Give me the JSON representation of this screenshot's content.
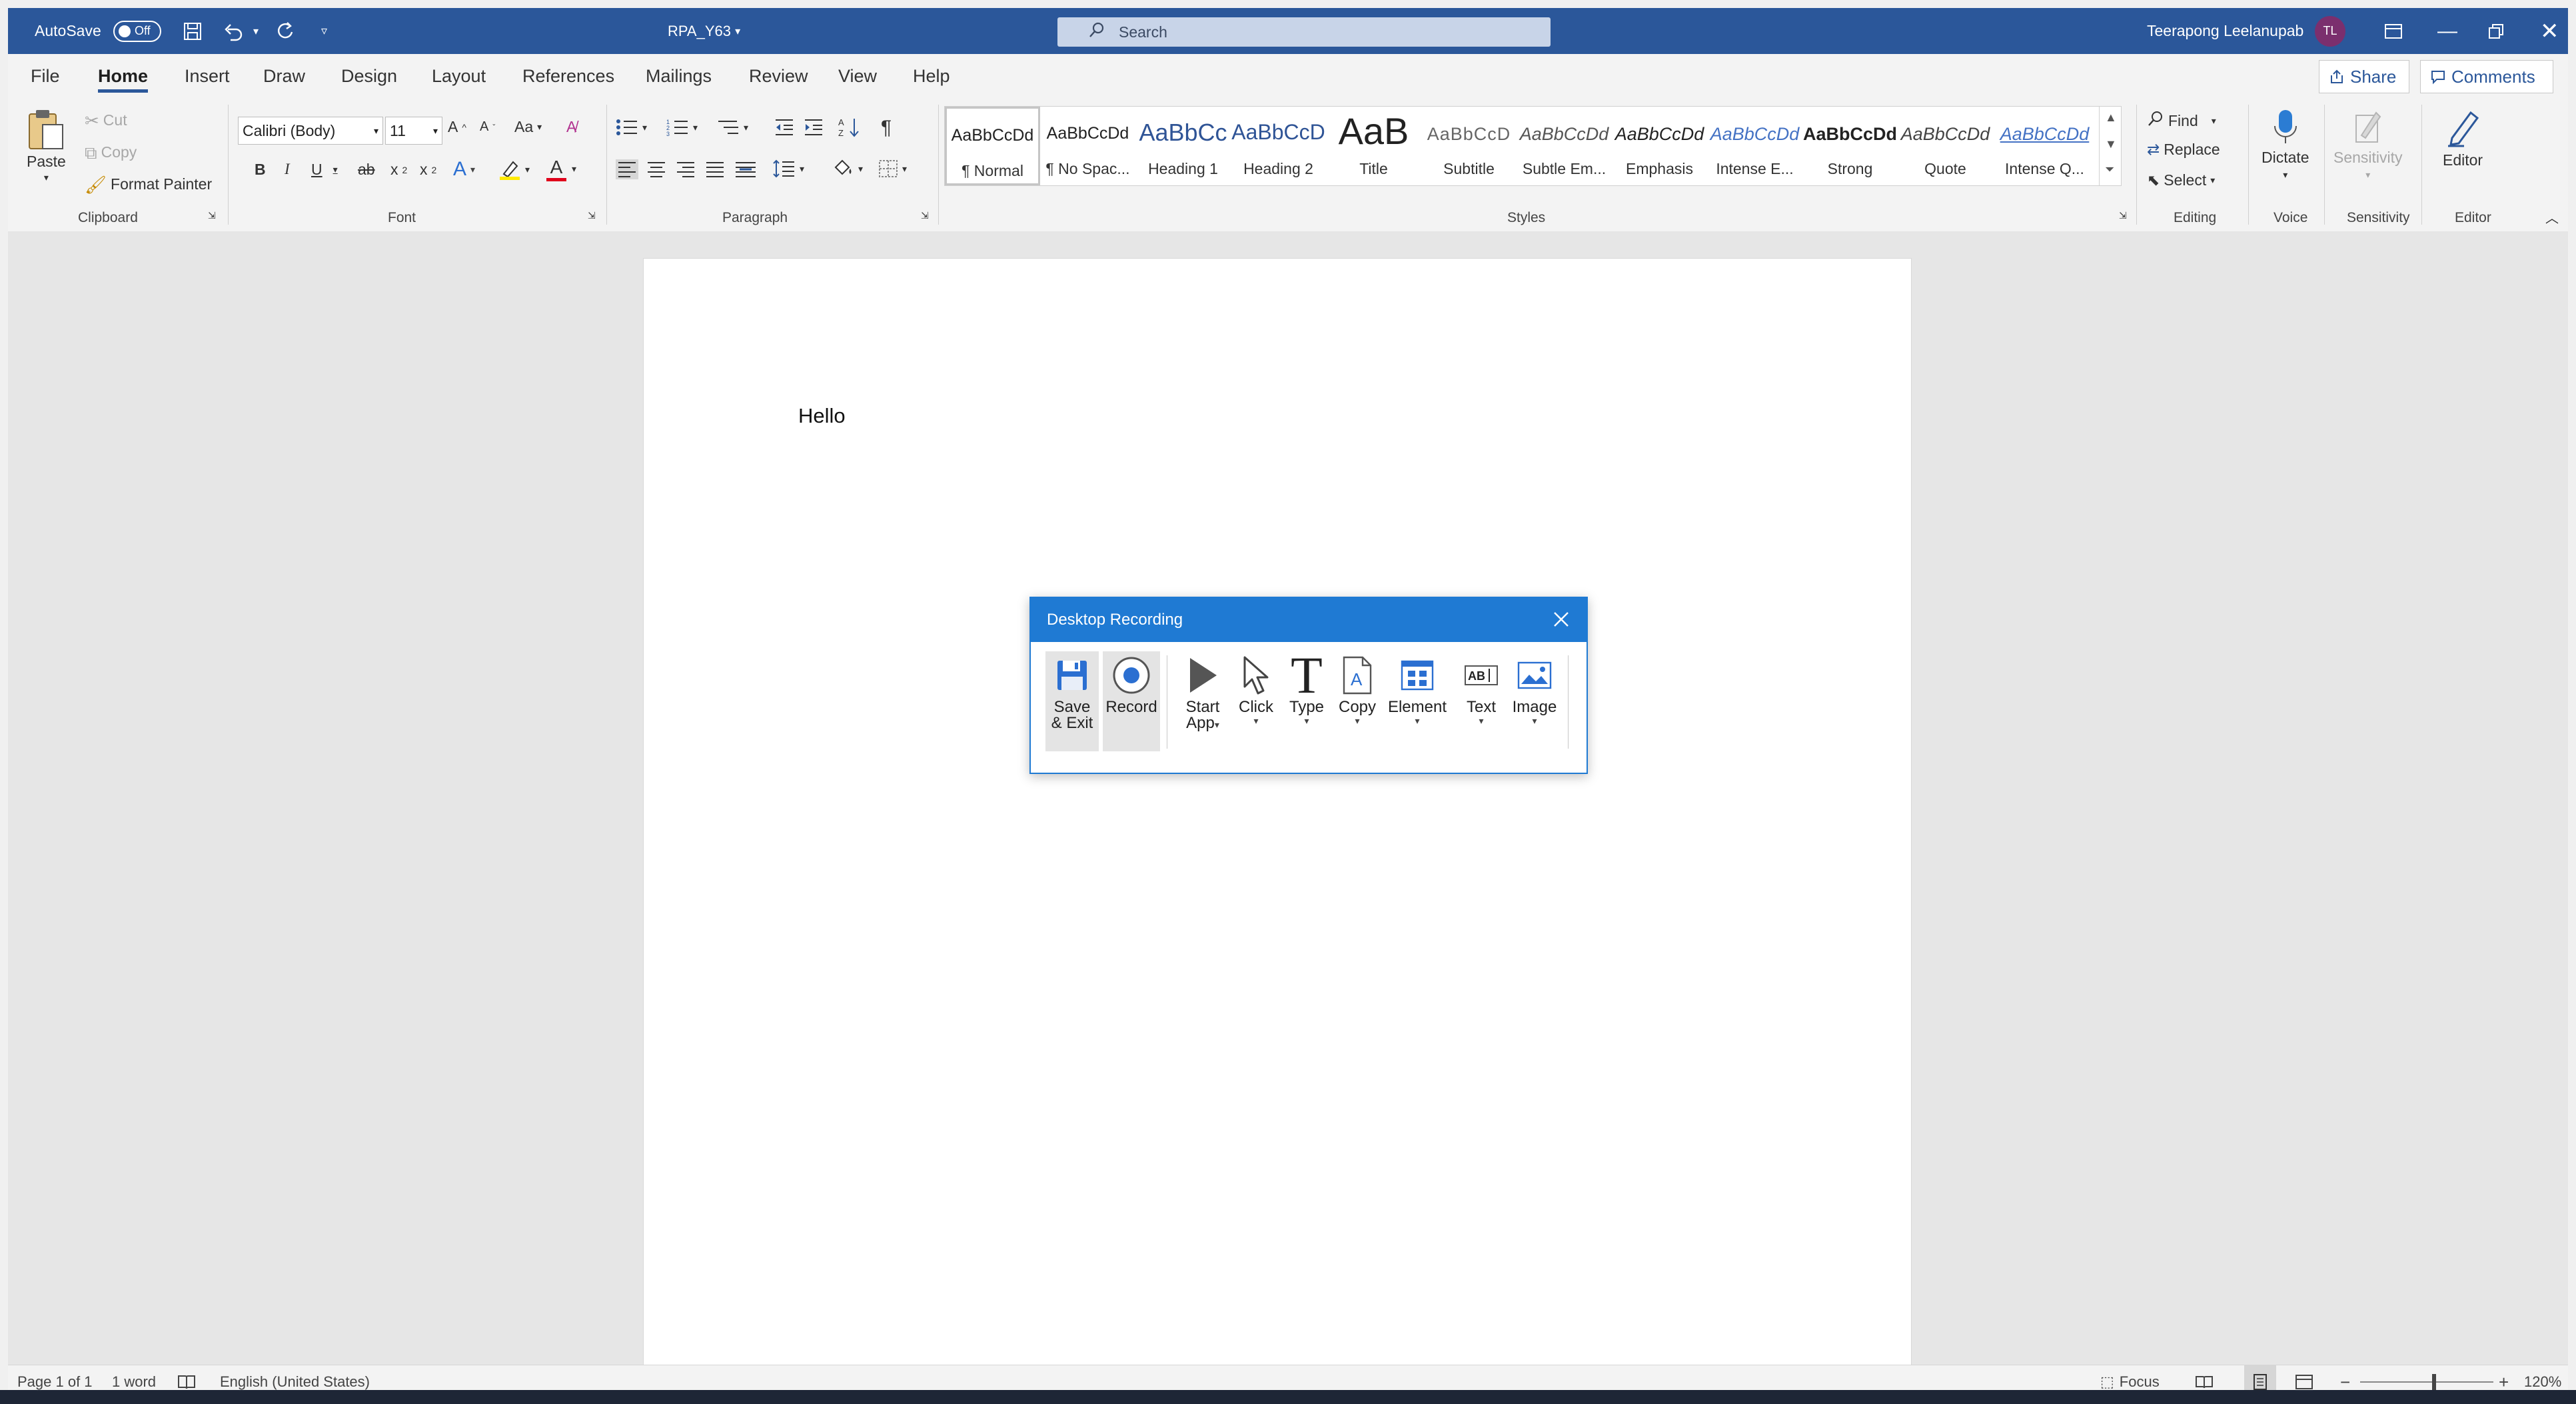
{
  "titlebar": {
    "autosave_label": "AutoSave",
    "autosave_state": "Off",
    "document_title": "RPA_Y63",
    "search_placeholder": "Search",
    "user_name": "Teerapong Leelanupab",
    "user_initials": "TL",
    "bg_color": "#2b579a"
  },
  "tabs": [
    {
      "label": "File"
    },
    {
      "label": "Home",
      "active": true
    },
    {
      "label": "Insert"
    },
    {
      "label": "Draw"
    },
    {
      "label": "Design"
    },
    {
      "label": "Layout"
    },
    {
      "label": "References"
    },
    {
      "label": "Mailings"
    },
    {
      "label": "Review"
    },
    {
      "label": "View"
    },
    {
      "label": "Help"
    }
  ],
  "share_label": "Share",
  "comments_label": "Comments",
  "clipboard": {
    "paste": "Paste",
    "cut": "Cut",
    "copy": "Copy",
    "format_painter": "Format Painter",
    "group": "Clipboard"
  },
  "font": {
    "name": "Calibri (Body)",
    "size": "11",
    "group": "Font",
    "change_case": "Aa"
  },
  "paragraph": {
    "group": "Paragraph"
  },
  "styles": {
    "group": "Styles",
    "items": [
      {
        "sample": "AaBbCcDd",
        "name": "¶ Normal",
        "selected": true
      },
      {
        "sample": "AaBbCcDd",
        "name": "¶ No Spac..."
      },
      {
        "sample": "AaBbCc",
        "name": "Heading 1"
      },
      {
        "sample": "AaBbCcD",
        "name": "Heading 2"
      },
      {
        "sample": "AaB",
        "name": "Title"
      },
      {
        "sample": "AaBbCcD",
        "name": "Subtitle"
      },
      {
        "sample": "AaBbCcDd",
        "name": "Subtle Em..."
      },
      {
        "sample": "AaBbCcDd",
        "name": "Emphasis"
      },
      {
        "sample": "AaBbCcDd",
        "name": "Intense E..."
      },
      {
        "sample": "AaBbCcDd",
        "name": "Strong"
      },
      {
        "sample": "AaBbCcDd",
        "name": "Quote"
      },
      {
        "sample": "AaBbCcDd",
        "name": "Intense Q..."
      }
    ]
  },
  "editing": {
    "find": "Find",
    "replace": "Replace",
    "select": "Select",
    "group": "Editing"
  },
  "voice": {
    "dictate": "Dictate",
    "group": "Voice"
  },
  "sensitivity": {
    "button": "Sensitivity",
    "group": "Sensitivity"
  },
  "editor": {
    "button": "Editor",
    "group": "Editor"
  },
  "document": {
    "text": "Hello"
  },
  "dialog": {
    "title": "Desktop Recording",
    "tools": [
      {
        "line1": "Save",
        "line2": "& Exit"
      },
      {
        "line1": "Record",
        "line2": ""
      },
      {
        "line1": "Start",
        "line2": "App"
      },
      {
        "line1": "Click",
        "line2": ""
      },
      {
        "line1": "Type",
        "line2": ""
      },
      {
        "line1": "Copy",
        "line2": ""
      },
      {
        "line1": "Element",
        "line2": ""
      },
      {
        "line1": "Text",
        "line2": ""
      },
      {
        "line1": "Image",
        "line2": ""
      }
    ],
    "accent_color": "#1f7ad3"
  },
  "statusbar": {
    "page": "Page 1 of 1",
    "words": "1 word",
    "language": "English (United States)",
    "focus": "Focus",
    "zoom": "120%"
  }
}
